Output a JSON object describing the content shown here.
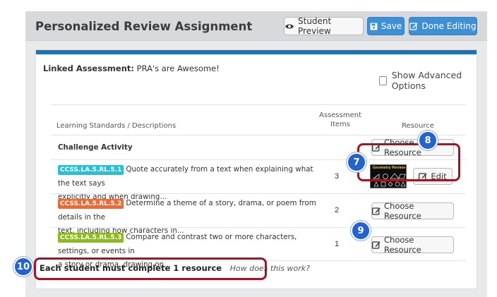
{
  "header": {
    "title": "Personalized Review Assignment",
    "student_preview": "Student Preview",
    "save": "Save",
    "done_editing": "Done Editing"
  },
  "linked": {
    "label": "Linked Assessment:",
    "value": "PRA's are Awesome!"
  },
  "advanced_options": "Show Advanced Options",
  "table": {
    "col_standards": "Learning Standards / Descriptions",
    "col_items_line1": "Assessment",
    "col_items_line2": "Items",
    "col_resource": "Resource",
    "challenge": {
      "label": "Challenge Activity",
      "button": "Choose Resource"
    },
    "rows": [
      {
        "code": "CCSS.LA.5.RL.5.1",
        "color": "#29c0d6",
        "line1": "Quote accurately from a text when explaining what the text says",
        "line2": "explicitly and when drawing...",
        "count": "3",
        "thumb_title": "Geometry Review",
        "edit": "Edit"
      },
      {
        "code": "CCSS.LA.5.RL.5.2",
        "color": "#ee6a35",
        "line1": "Determine a theme of a story, drama, or poem from details in the",
        "line2": "text, including how characters in...",
        "count": "2",
        "button": "Choose Resource"
      },
      {
        "code": "CCSS.LA.5.RL.5.3",
        "color": "#8dbb1c",
        "line1": "Compare and contrast two or more characters, settings, or events in",
        "line2": "a story or drama, drawing on...",
        "count": "1",
        "button": "Choose Resource"
      }
    ]
  },
  "footer": {
    "requirement": "Each student must complete 1 resource",
    "help_link": "How does this work?"
  },
  "callouts": [
    "7",
    "8",
    "9",
    "10"
  ],
  "colors": {
    "accent": "#3d8fd6",
    "card_bar": "#1a73b8",
    "highlight": "#a01522",
    "callout": "#2363d1"
  }
}
